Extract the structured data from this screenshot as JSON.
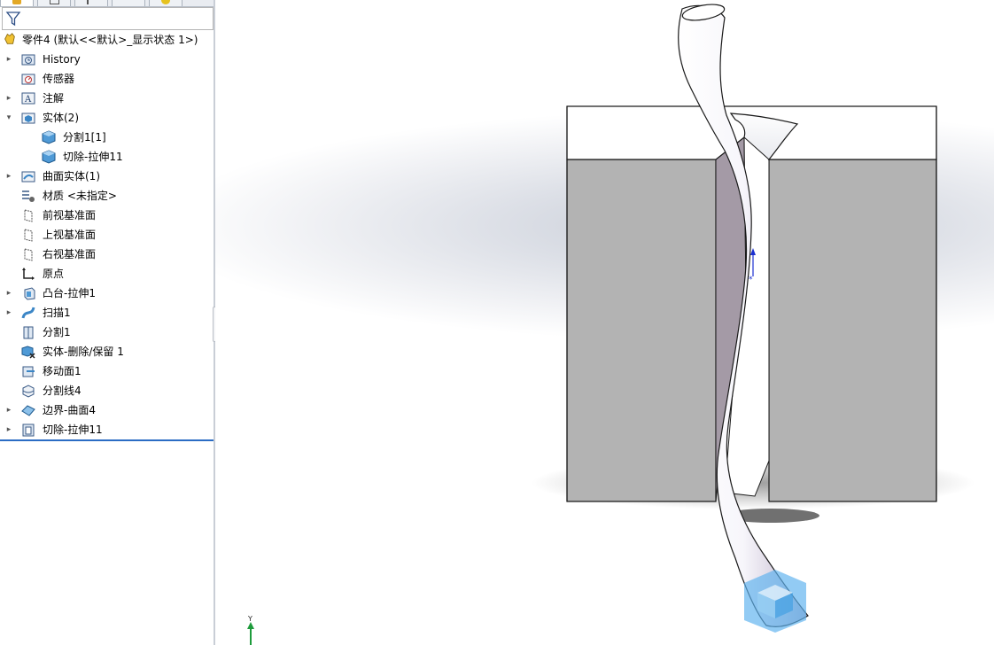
{
  "feature_tree": {
    "root_label": "零件4  (默认<<默认>_显示状态 1>)",
    "items": [
      {
        "label": "History",
        "icon": "history-folder-icon",
        "expandable": true,
        "indent": 0
      },
      {
        "label": "传感器",
        "icon": "sensors-icon",
        "expandable": false,
        "indent": 0
      },
      {
        "label": "注解",
        "icon": "annotations-icon",
        "expandable": true,
        "indent": 0
      },
      {
        "label": "实体(2)",
        "icon": "solid-bodies-folder-icon",
        "expandable": true,
        "expanded": true,
        "indent": 0
      },
      {
        "label": "分割1[1]",
        "icon": "solid-body-icon",
        "expandable": false,
        "indent": 1
      },
      {
        "label": "切除-拉伸11",
        "icon": "solid-body-icon",
        "expandable": false,
        "indent": 1
      },
      {
        "label": "曲面实体(1)",
        "icon": "surface-bodies-folder-icon",
        "expandable": true,
        "indent": 0
      },
      {
        "label": "材质 <未指定>",
        "icon": "material-icon",
        "expandable": false,
        "indent": 0
      },
      {
        "label": "前视基准面",
        "icon": "plane-icon",
        "expandable": false,
        "indent": 0
      },
      {
        "label": "上视基准面",
        "icon": "plane-icon",
        "expandable": false,
        "indent": 0
      },
      {
        "label": "右视基准面",
        "icon": "plane-icon",
        "expandable": false,
        "indent": 0
      },
      {
        "label": "原点",
        "icon": "origin-icon",
        "expandable": false,
        "indent": 0
      },
      {
        "label": "凸台-拉伸1",
        "icon": "boss-extrude-icon",
        "expandable": true,
        "indent": 0
      },
      {
        "label": "扫描1",
        "icon": "sweep-icon",
        "expandable": true,
        "indent": 0
      },
      {
        "label": "分割1",
        "icon": "split-icon",
        "expandable": false,
        "indent": 0
      },
      {
        "label": "实体-删除/保留 1",
        "icon": "delete-body-icon",
        "expandable": false,
        "indent": 0
      },
      {
        "label": "移动面1",
        "icon": "move-face-icon",
        "expandable": false,
        "indent": 0
      },
      {
        "label": "分割线4",
        "icon": "split-line-icon",
        "expandable": false,
        "indent": 0
      },
      {
        "label": "边界-曲面4",
        "icon": "boundary-surface-icon",
        "expandable": true,
        "indent": 0
      },
      {
        "label": "切除-拉伸11",
        "icon": "cut-extrude-icon",
        "expandable": true,
        "indent": 0
      }
    ]
  },
  "triad": {
    "y_label": "Y"
  },
  "colors": {
    "body_gray": "#b3b3b3",
    "slot_face": "#a49aa6",
    "top_face": "#ffffff",
    "edge": "#1a1a1a",
    "accent": "#2b6cc4"
  }
}
